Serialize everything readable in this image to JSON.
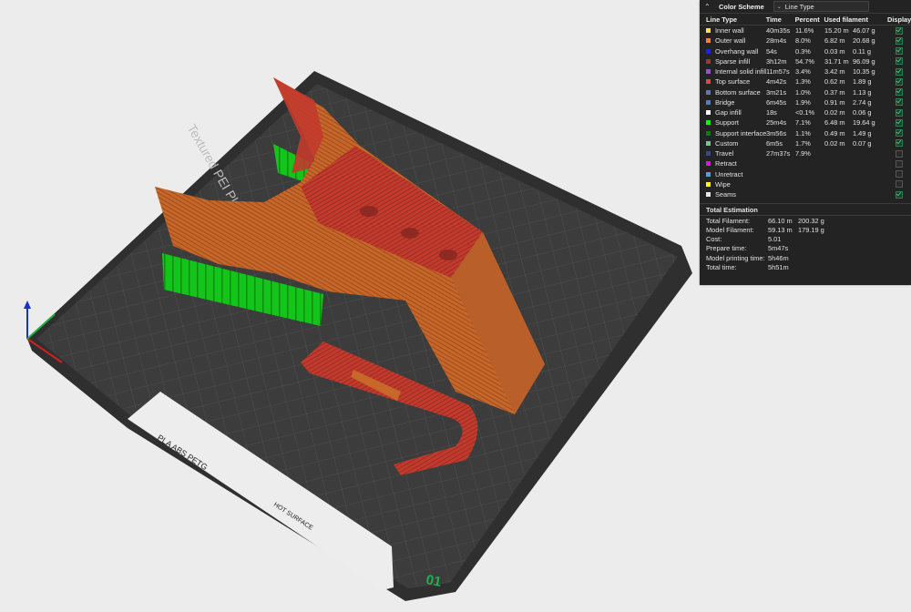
{
  "viewport": {
    "bed_texture_label": "Textured PEI Plate",
    "plate_labels": [
      "PLA ABS PETG",
      "HOT SURFACE"
    ],
    "plate_number": "01"
  },
  "legend": {
    "title": "Color Scheme",
    "scheme_value": "Line Type",
    "headers": {
      "type": "Line Type",
      "time": "Time",
      "percent": "Percent",
      "used": "Used filament",
      "display": "Display"
    },
    "rows": [
      {
        "label": "Inner wall",
        "color": "#ffe633",
        "time": "40m35s",
        "percent": "11.6%",
        "length": "15.20 m",
        "weight": "46.07 g",
        "display": true
      },
      {
        "label": "Outer wall",
        "color": "#ff7d38",
        "time": "28m4s",
        "percent": "8.0%",
        "length": "6.82 m",
        "weight": "20.68 g",
        "display": true
      },
      {
        "label": "Overhang wall",
        "color": "#1f1fff",
        "time": "54s",
        "percent": "0.3%",
        "length": "0.03 m",
        "weight": "0.11 g",
        "display": true
      },
      {
        "label": "Sparse infill",
        "color": "#b03029",
        "time": "3h12m",
        "percent": "54.7%",
        "length": "31.71 m",
        "weight": "96.09 g",
        "display": true
      },
      {
        "label": "Internal solid infill",
        "color": "#9654cc",
        "time": "11m57s",
        "percent": "3.4%",
        "length": "3.42 m",
        "weight": "10.35 g",
        "display": true
      },
      {
        "label": "Top surface",
        "color": "#f04040",
        "time": "4m42s",
        "percent": "1.3%",
        "length": "0.62 m",
        "weight": "1.89 g",
        "display": true
      },
      {
        "label": "Bottom surface",
        "color": "#6070d0",
        "time": "3m21s",
        "percent": "1.0%",
        "length": "0.37 m",
        "weight": "1.13 g",
        "display": true
      },
      {
        "label": "Bridge",
        "color": "#4d80ba",
        "time": "6m45s",
        "percent": "1.9%",
        "length": "0.91 m",
        "weight": "2.74 g",
        "display": true
      },
      {
        "label": "Gap infill",
        "color": "#ffffff",
        "time": "18s",
        "percent": "<0.1%",
        "length": "0.02 m",
        "weight": "0.06 g",
        "display": true
      },
      {
        "label": "Support",
        "color": "#00ff00",
        "time": "25m4s",
        "percent": "7.1%",
        "length": "6.48 m",
        "weight": "19.64 g",
        "display": true
      },
      {
        "label": "Support interface",
        "color": "#008000",
        "time": "3m56s",
        "percent": "1.1%",
        "length": "0.49 m",
        "weight": "1.49 g",
        "display": true
      },
      {
        "label": "Custom",
        "color": "#5ed194",
        "time": "6m5s",
        "percent": "1.7%",
        "length": "0.02 m",
        "weight": "0.07 g",
        "display": true
      },
      {
        "label": "Travel",
        "color": "#38488a",
        "time": "27m37s",
        "percent": "7.9%",
        "length": "",
        "weight": "",
        "display": false
      },
      {
        "label": "Retract",
        "color": "#ff00ff",
        "time": "",
        "percent": "",
        "length": "",
        "weight": "",
        "display": false
      },
      {
        "label": "Unretract",
        "color": "#3ea8e0",
        "time": "",
        "percent": "",
        "length": "",
        "weight": "",
        "display": false
      },
      {
        "label": "Wipe",
        "color": "#ffff00",
        "time": "",
        "percent": "",
        "length": "",
        "weight": "",
        "display": false
      },
      {
        "label": "Seams",
        "color": "#e6e6e6",
        "time": "",
        "percent": "",
        "length": "",
        "weight": "",
        "display": true
      }
    ],
    "total": {
      "title": "Total Estimation",
      "rows": [
        {
          "label": "Total Filament:",
          "v1": "66.10 m",
          "v2": "200.32 g"
        },
        {
          "label": "Model Filament:",
          "v1": "59.13 m",
          "v2": "179.19 g"
        },
        {
          "label": "Cost:",
          "v1": "5.01",
          "v2": ""
        },
        {
          "label": "Prepare time:",
          "v1": "5m47s",
          "v2": ""
        },
        {
          "label": "Model printing time:",
          "v1": "5h46m",
          "v2": ""
        },
        {
          "label": "Total time:",
          "v1": "5h51m",
          "v2": ""
        }
      ]
    }
  }
}
